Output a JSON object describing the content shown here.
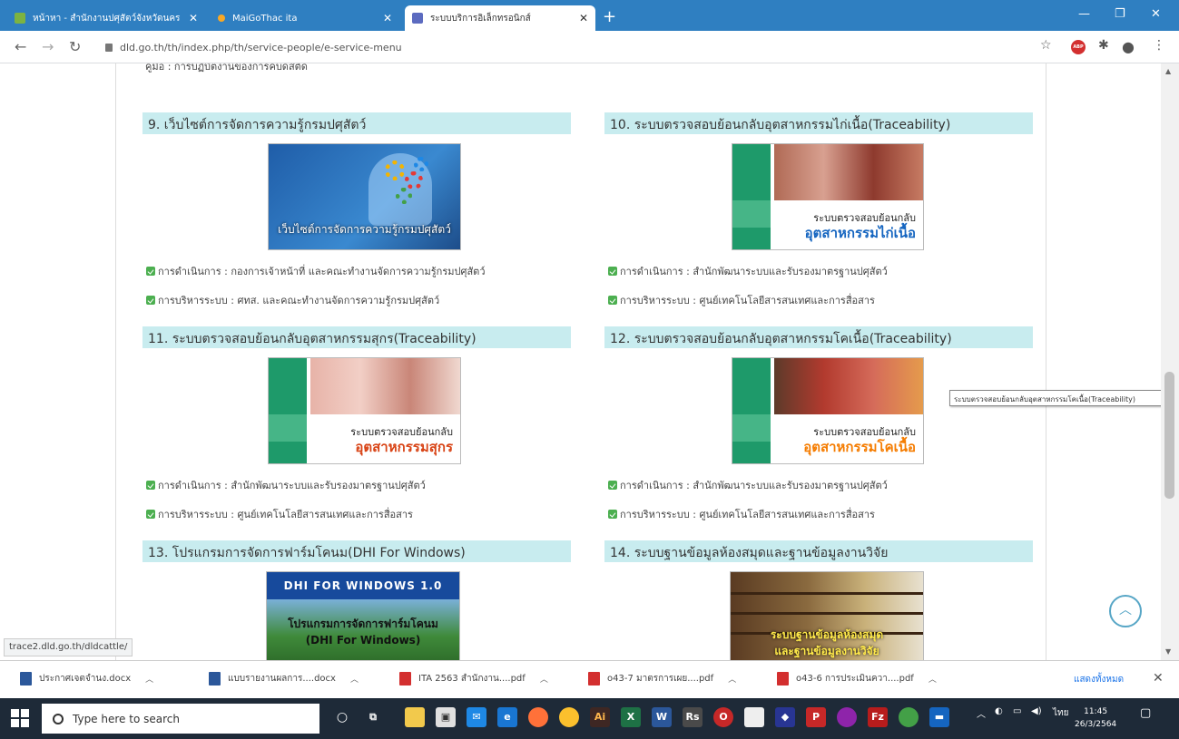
{
  "browser": {
    "tabs": [
      {
        "title": "หน้าหา - สำนักงานปศุสัตว์จังหวัดนคร",
        "active": false
      },
      {
        "title": "MaiGoThac ita",
        "active": false
      },
      {
        "title": "ระบบบริการอิเล็กทรอนิกส์",
        "active": true
      }
    ],
    "url": "dld.go.th/th/index.php/th/service-people/e-service-menu"
  },
  "page": {
    "cut_text": "คู่มือ : การบฏิบัตงานของการคบดสตัด",
    "services": [
      {
        "heading": "9. เว็บไซต์การจัดการความรู้กรมปศุสัตว์",
        "thumb_caption": "เว็บไซต์การจัดการความรู้กรมปศุสัตว์",
        "operator_label": "การดำเนินการ",
        "operator": "กองการเจ้าหน้าที่ และคณะทำงานจัดการความรู้กรมปศุสัตว์",
        "admin_label": "การบริหารระบบ",
        "admin": "ศทส. และคณะทำงานจัดการความรู้กรมปศุสัตว์"
      },
      {
        "heading": "10. ระบบตรวจสอบย้อนกลับอุตสาหกรรมไก่เนื้อ(Traceability)",
        "thumb_line1": "ระบบตรวจสอบย้อนกลับ",
        "thumb_line2": "อุตสาหกรรมไก่เนื้อ",
        "operator_label": "การดำเนินการ",
        "operator": "สำนักพัฒนาระบบและรับรองมาตรฐานปศุสัตว์",
        "admin_label": "การบริหารระบบ",
        "admin": "ศูนย์เทคโนโลยีสารสนเทศและการสื่อสาร"
      },
      {
        "heading": "11. ระบบตรวจสอบย้อนกลับอุตสาหกรรมสุกร(Traceability)",
        "thumb_line1": "ระบบตรวจสอบย้อนกลับ",
        "thumb_line2": "อุตสาหกรรมสุกร",
        "operator_label": "การดำเนินการ",
        "operator": "สำนักพัฒนาระบบและรับรองมาตรฐานปศุสัตว์",
        "admin_label": "การบริหารระบบ",
        "admin": "ศูนย์เทคโนโลยีสารสนเทศและการสื่อสาร"
      },
      {
        "heading": "12. ระบบตรวจสอบย้อนกลับอุตสาหกรรมโคเนื้อ(Traceability)",
        "thumb_line1": "ระบบตรวจสอบย้อนกลับ",
        "thumb_line2": "อุตสาหกรรมโคเนื้อ",
        "operator_label": "การดำเนินการ",
        "operator": "สำนักพัฒนาระบบและรับรองมาตรฐานปศุสัตว์",
        "admin_label": "การบริหารระบบ",
        "admin": "ศูนย์เทคโนโลยีสารสนเทศและการสื่อสาร"
      },
      {
        "heading": "13. โปรแกรมการจัดการฟาร์มโคนม(DHI For Windows)",
        "thumb_band": "DHI FOR WINDOWS 1.0",
        "thumb_line1": "โปรแกรมการจัดการฟาร์มโคนม",
        "thumb_line2": "(DHI For Windows)"
      },
      {
        "heading": "14. ระบบฐานข้อมูลห้องสมุดและฐานข้อมูลงานวิจัย",
        "thumb_line1": "ระบบฐานข้อมูลห้องสมุด",
        "thumb_line2": "และฐานข้อมูลงานวิจัย"
      }
    ],
    "tooltip": "ระบบตรวจสอบย้อนกลับอุตสาหกรรมโคเนื้อ(Traceability)"
  },
  "status_url": "trace2.dld.go.th/dldcattle/",
  "downloads": {
    "items": [
      {
        "name": "ประกาศเจตจำนง.docx",
        "type": "word"
      },
      {
        "name": "แบบรายงานผลการ....docx",
        "type": "word"
      },
      {
        "name": "ITA 2563 สำนักงาน....pdf",
        "type": "pdf"
      },
      {
        "name": "o43-7 มาตรการเผย....pdf",
        "type": "pdf"
      },
      {
        "name": "o43-6 การประเมินควา....pdf",
        "type": "pdf"
      }
    ],
    "show_all": "แสดงทั้งหมด"
  },
  "taskbar": {
    "search_placeholder": "Type here to search",
    "lang": "ไทย",
    "time": "11:45",
    "date": "26/3/2564"
  },
  "colors": {
    "tab_strip": "#2f7fc1",
    "section_header": "#c8ecef",
    "bullet_green": "#4caf50",
    "trace_green": "#1e9a6a",
    "chicken_blue": "#1565c0",
    "pig_red": "#d84315",
    "beef_orange": "#f57c00"
  }
}
